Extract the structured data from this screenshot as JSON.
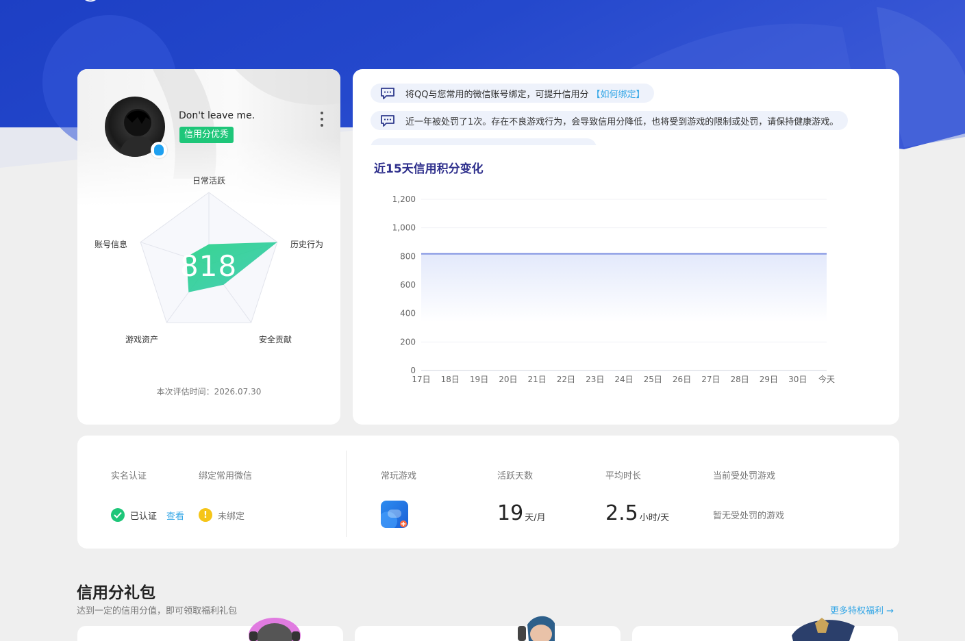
{
  "profile": {
    "username": "Don't leave me.",
    "credit_tag": "信用分优秀",
    "score": "818",
    "radar_labels": {
      "daily": "日常活跃",
      "history": "历史行为",
      "security": "安全贡献",
      "assets": "游戏资产",
      "account": "账号信息"
    },
    "radar_values": {
      "daily": 0.28,
      "history": 1.0,
      "security": 0.35,
      "assets": 0.48,
      "account": 0.33
    },
    "eval_time": "本次评估时间：2026.07.30"
  },
  "notices": [
    {
      "text": "将QQ与您常用的微信账号绑定，可提升信用分",
      "link": "【如何绑定】"
    },
    {
      "text": "近一年被处罚了1次。存在不良游戏行为，会导致信用分降低，也将受到游戏的限制或处罚，请保持健康游戏。",
      "link": ""
    }
  ],
  "chart": {
    "title": "近15天信用积分变化"
  },
  "chart_data": {
    "type": "area",
    "title": "近15天信用积分变化",
    "categories": [
      "17日",
      "18日",
      "19日",
      "20日",
      "21日",
      "22日",
      "23日",
      "24日",
      "25日",
      "26日",
      "27日",
      "28日",
      "29日",
      "30日",
      "今天"
    ],
    "values": [
      818,
      818,
      818,
      818,
      818,
      818,
      818,
      818,
      818,
      818,
      818,
      818,
      818,
      818,
      818
    ],
    "ylim": [
      0,
      1200
    ],
    "yticks": [
      "0",
      "200",
      "400",
      "600",
      "800",
      "1,000",
      "1,200"
    ],
    "grid": true,
    "colors": {
      "line": "#7b8fe0",
      "fill": "#e3e9fb"
    }
  },
  "stats": {
    "realname_head": "实名认证",
    "realname_val": "已认证",
    "realname_link": "查看",
    "wechat_head": "绑定常用微信",
    "wechat_val": "未绑定",
    "game_head": "常玩游戏",
    "active_head": "活跃天数",
    "active_num": "19",
    "active_unit": "天/月",
    "avg_head": "平均时长",
    "avg_num": "2.5",
    "avg_unit": "小时/天",
    "penalty_head": "当前受处罚游戏",
    "penalty_val": "暂无受处罚的游戏"
  },
  "gift": {
    "title": "信用分礼包",
    "subtitle": "达到一定的信用分值，即可领取福利礼包",
    "more": "更多特权福利 →"
  },
  "icons": [
    "logo-icon",
    "qq-icon",
    "more-icon",
    "chat-icon",
    "check-icon",
    "warning-icon",
    "game-icon",
    "arrow-right-icon"
  ],
  "colors": {
    "brand_blue": "#2446c8",
    "green": "#1ec679",
    "link": "#33a6e6",
    "title_navy": "#2e2f8c"
  }
}
